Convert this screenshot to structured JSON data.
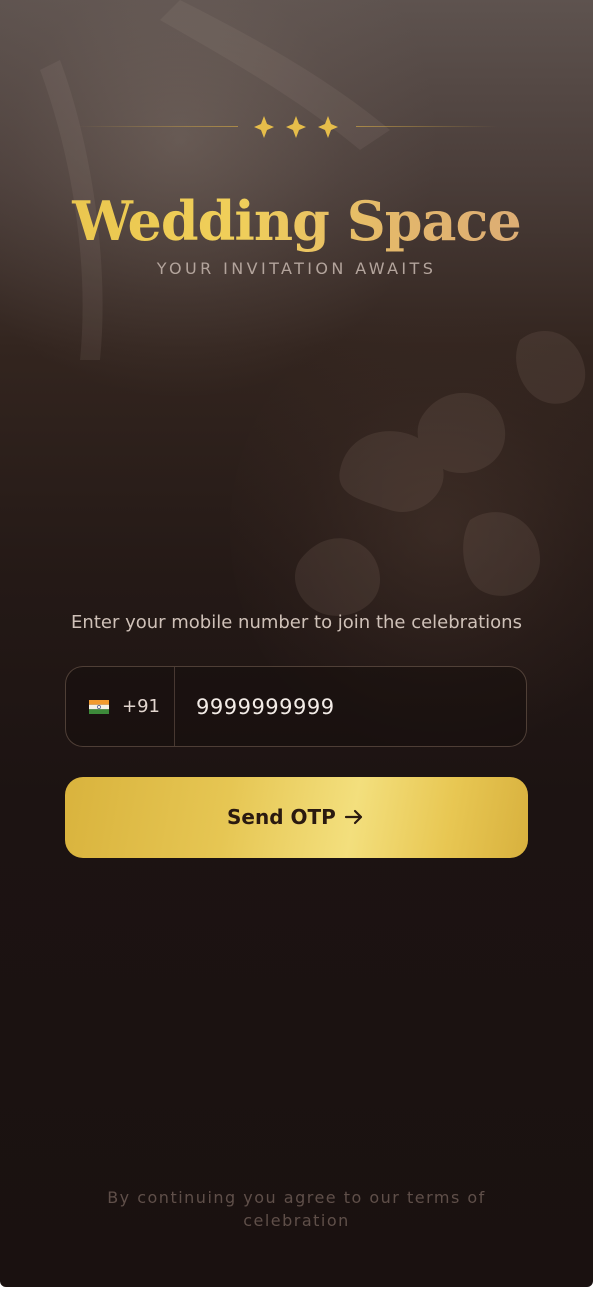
{
  "app": {
    "title": "Wedding Space",
    "tagline": "YOUR INVITATION AWAITS"
  },
  "login": {
    "prompt": "Enter your mobile number to join the celebrations",
    "country_code": "+91",
    "country_flag_icon": "india-flag-icon",
    "phone_value": "9999999999",
    "send_button_label": "Send OTP",
    "send_button_icon": "arrow-right-icon"
  },
  "footer": {
    "terms_text": "By continuing you agree to our terms of celebration"
  },
  "colors": {
    "accent_gold": "#e6c653",
    "background_dark": "#1a1110",
    "button_text": "#2a1a10"
  }
}
